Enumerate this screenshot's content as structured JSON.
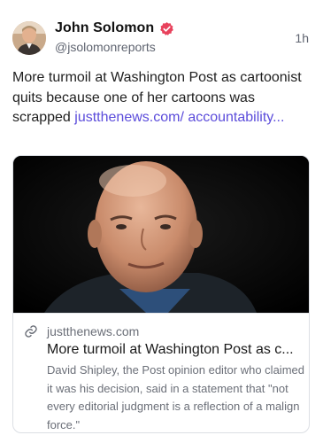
{
  "post": {
    "author": {
      "display_name": "John Solomon",
      "handle": "@jsolomonreports",
      "avatar_icon": "person-avatar",
      "verified_icon": "verified-badge-icon",
      "verified_color": "#e8425c"
    },
    "timestamp": "1h",
    "text": "More turmoil at Washington Post as cartoonist quits because one of her cartoons was scrapped",
    "inline_link": "justthenews.com/ accountability...",
    "link_color": "#5b4cdb"
  },
  "link_preview": {
    "image_icon": "article-photo",
    "link_icon": "link-icon",
    "domain": "justthenews.com",
    "title": "More turmoil at Washington Post as c...",
    "description": "David Shipley, the Post opinion editor who claimed it was his decision, said in a statement that \"not every editorial judgment is a reflection of a malign force.\""
  }
}
